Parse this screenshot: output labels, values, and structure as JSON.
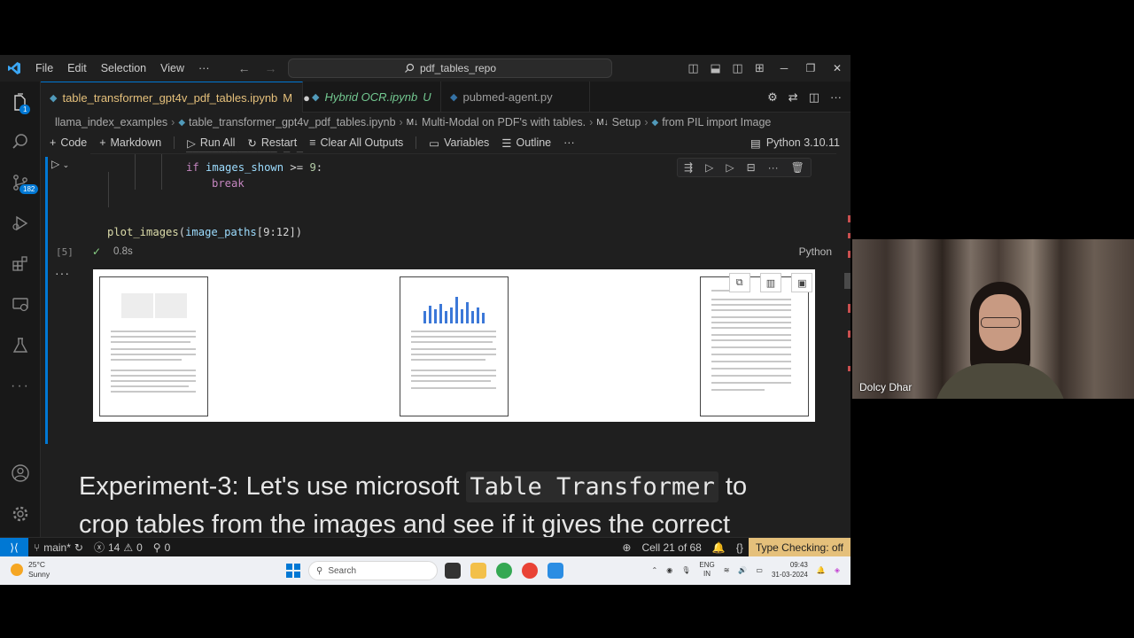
{
  "titlebar": {
    "menu": [
      "File",
      "Edit",
      "Selection",
      "View",
      "···"
    ],
    "search": "pdf_tables_repo"
  },
  "activity": {
    "source_control_badge": "182",
    "explorer_badge": "1"
  },
  "tabs": [
    {
      "label": "table_transformer_gpt4v_pdf_tables.ipynb",
      "badge": "M",
      "active": true
    },
    {
      "label": "Hybrid OCR.ipynb",
      "badge": "U",
      "active": false
    },
    {
      "label": "pubmed-agent.py",
      "badge": "",
      "active": false
    }
  ],
  "breadcrumb": [
    "llama_index_examples",
    "table_transformer_gpt4v_pdf_tables.ipynb",
    "Multi-Modal on PDF's with tables.",
    "Setup",
    "from PIL import Image"
  ],
  "breadcrumb_prefix": [
    "M↓",
    "M↓"
  ],
  "toolbar": {
    "code": "Code",
    "markdown": "Markdown",
    "run_all": "Run All",
    "restart": "Restart",
    "clear": "Clear All Outputs",
    "variables": "Variables",
    "outline": "Outline",
    "more": "···",
    "kernel": "Python 3.10.11"
  },
  "cell": {
    "line1": {
      "kw": "if",
      "var": "images_shown",
      "op": " >= ",
      "num": "9",
      "end": ":"
    },
    "line2": {
      "kw": "break"
    },
    "line3": {
      "fn": "plot_images",
      "open": "(",
      "var": "image_paths",
      "rest": "[9:12])"
    },
    "exec_count": "[5]",
    "duration": "0.8s",
    "language": "Python"
  },
  "markdown": {
    "prefix": "Experiment-3: Let's use microsoft ",
    "code": "Table Transformer",
    "suffix": " to",
    "line2": "crop tables from the images and see if it gives the correct"
  },
  "statusbar": {
    "branch": "main*",
    "errors": "14",
    "warnings": "0",
    "ports": "0",
    "cell_pos": "Cell 21 of 68",
    "type_checking": "Type Checking: off"
  },
  "taskbar": {
    "temp": "25°C",
    "weather": "Sunny",
    "search": "Search",
    "lang1": "ENG",
    "lang2": "IN",
    "time": "09:43",
    "date": "31-03-2024"
  },
  "webcam": {
    "name": "Dolcy Dhar"
  }
}
